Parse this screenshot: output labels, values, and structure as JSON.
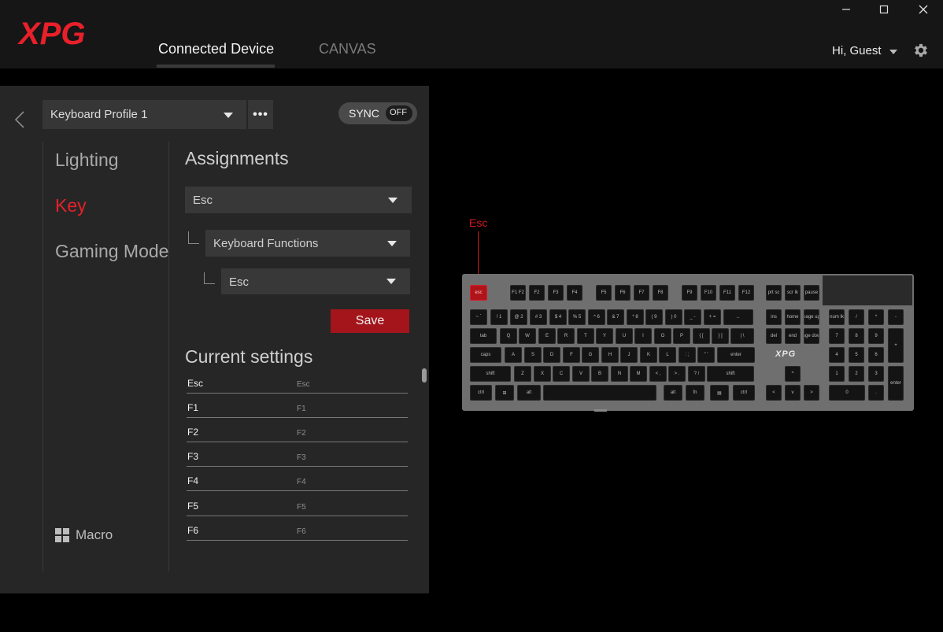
{
  "app": {
    "logo_text": "XPG",
    "brand_color": "#e8202a",
    "tabs": [
      {
        "label": "Connected Device",
        "active": true
      },
      {
        "label": "CANVAS",
        "active": false
      }
    ],
    "user_greeting": "Hi, Guest",
    "window_controls": [
      "minimize-icon",
      "maximize-icon",
      "close-icon"
    ]
  },
  "profile": {
    "selected": "Keyboard Profile 1",
    "more_label": "•••",
    "sync_label": "SYNC",
    "sync_state": "OFF"
  },
  "sidebar": {
    "items": [
      {
        "label": "Lighting",
        "active": false
      },
      {
        "label": "Key",
        "active": true
      },
      {
        "label": "Gaming Mode",
        "active": false
      }
    ],
    "macro_label": "Macro"
  },
  "assignments": {
    "title": "Assignments",
    "key_select": "Esc",
    "category_select": "Keyboard Functions",
    "function_select": "Esc",
    "save_label": "Save"
  },
  "current_settings": {
    "title": "Current settings",
    "rows": [
      {
        "key": "Esc",
        "value": "Esc"
      },
      {
        "key": "F1",
        "value": "F1"
      },
      {
        "key": "F2",
        "value": "F2"
      },
      {
        "key": "F3",
        "value": "F3"
      },
      {
        "key": "F4",
        "value": "F4"
      },
      {
        "key": "F5",
        "value": "F5"
      },
      {
        "key": "F6",
        "value": "F6"
      }
    ]
  },
  "keyboard": {
    "selected_key_label": "Esc",
    "logo": "XPG",
    "rows": [
      [
        "esc",
        "F1 F2",
        "F2",
        "F3",
        "F4",
        "F5",
        "F6",
        "F7",
        "F8",
        "F9",
        "F10",
        "F11",
        "F12",
        "prt sc",
        "scr lk",
        "pause"
      ],
      [
        "~ `",
        "! 1",
        "@ 2",
        "# 3",
        "$ 4",
        "% 5",
        "^ 6",
        "& 7",
        "* 8",
        "( 9",
        ") 0",
        "_ -",
        "+ =",
        "←",
        "ins",
        "home",
        "page up",
        "num lk",
        "/",
        "*",
        "-"
      ],
      [
        "tab",
        "Q",
        "W",
        "E",
        "R",
        "T",
        "Y",
        "U",
        "I",
        "O",
        "P",
        "{ [",
        "} ]",
        "| \\",
        "del",
        "end",
        "page down",
        "7",
        "8",
        "9",
        "+"
      ],
      [
        "caps",
        "A",
        "S",
        "D",
        "F",
        "G",
        "H",
        "J",
        "K",
        "L",
        ": ;",
        "\" '",
        "enter",
        "4",
        "5",
        "6"
      ],
      [
        "shift",
        "Z",
        "X",
        "C",
        "V",
        "B",
        "N",
        "M",
        "< ,",
        "> .",
        "? /",
        "shift",
        "^",
        "1",
        "2",
        "3",
        "enter"
      ],
      [
        "ctrl",
        "⊞",
        "alt",
        "space",
        "alt",
        "fn",
        "▤",
        "ctrl",
        "<",
        "v",
        ">",
        "0",
        "."
      ]
    ]
  }
}
